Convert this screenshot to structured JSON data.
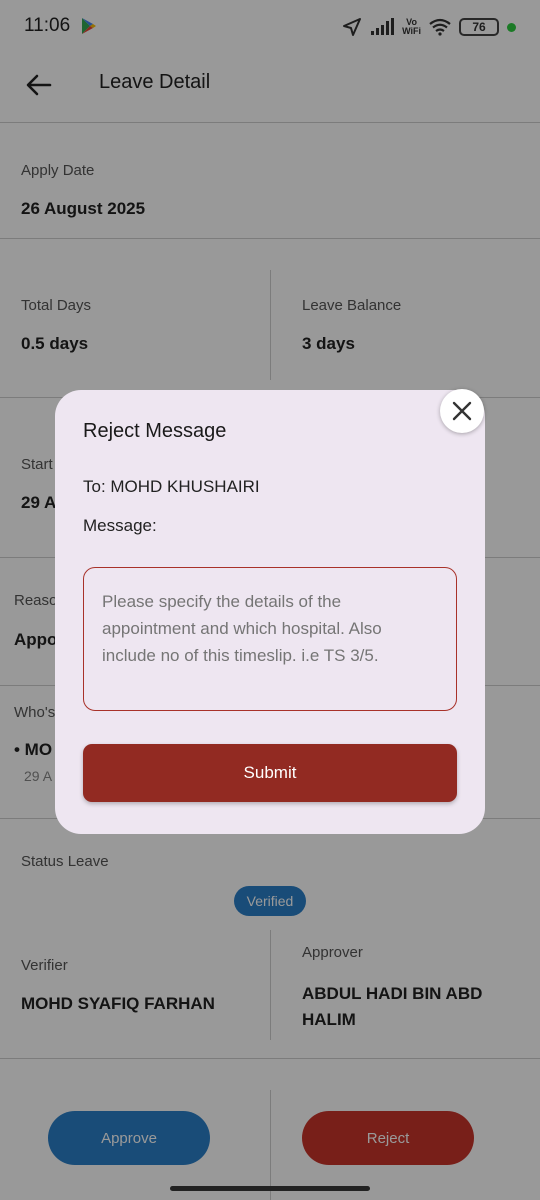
{
  "status_bar": {
    "time": "11:06",
    "battery": "76",
    "network_label_top": "Vo",
    "network_label_bottom": "WiFi"
  },
  "app_bar": {
    "title": "Leave Detail"
  },
  "apply_date": {
    "label": "Apply Date",
    "value": "26 August 2025"
  },
  "total_days": {
    "label": "Total Days",
    "value": "0.5 days"
  },
  "leave_balance": {
    "label": "Leave Balance",
    "value": "3 days"
  },
  "start_date": {
    "label": "Start",
    "value": "29 A"
  },
  "reason": {
    "label": "Reaso",
    "value": "Appo"
  },
  "whos": {
    "label": "Who's",
    "value": "• MO",
    "sub": "29 A"
  },
  "status_leave": {
    "label": "Status Leave",
    "badge": "Verified"
  },
  "verifier": {
    "label": "Verifier",
    "value": "MOHD SYAFIQ FARHAN"
  },
  "approver": {
    "label": "Approver",
    "value": "ABDUL HADI BIN ABD HALIM"
  },
  "actions": {
    "approve": "Approve",
    "reject": "Reject"
  },
  "dialog": {
    "title": "Reject Message",
    "to": "To: MOHD KHUSHAIRI",
    "message_label": "Message:",
    "message_placeholder": "Please specify the details of the appointment and which hospital. Also include no of this timeslip. i.e TS 3/5.",
    "submit": "Submit"
  },
  "colors": {
    "accent_red": "#922a22",
    "badge_blue": "#2a7fc8",
    "dialog_bg": "#eee6f1"
  }
}
